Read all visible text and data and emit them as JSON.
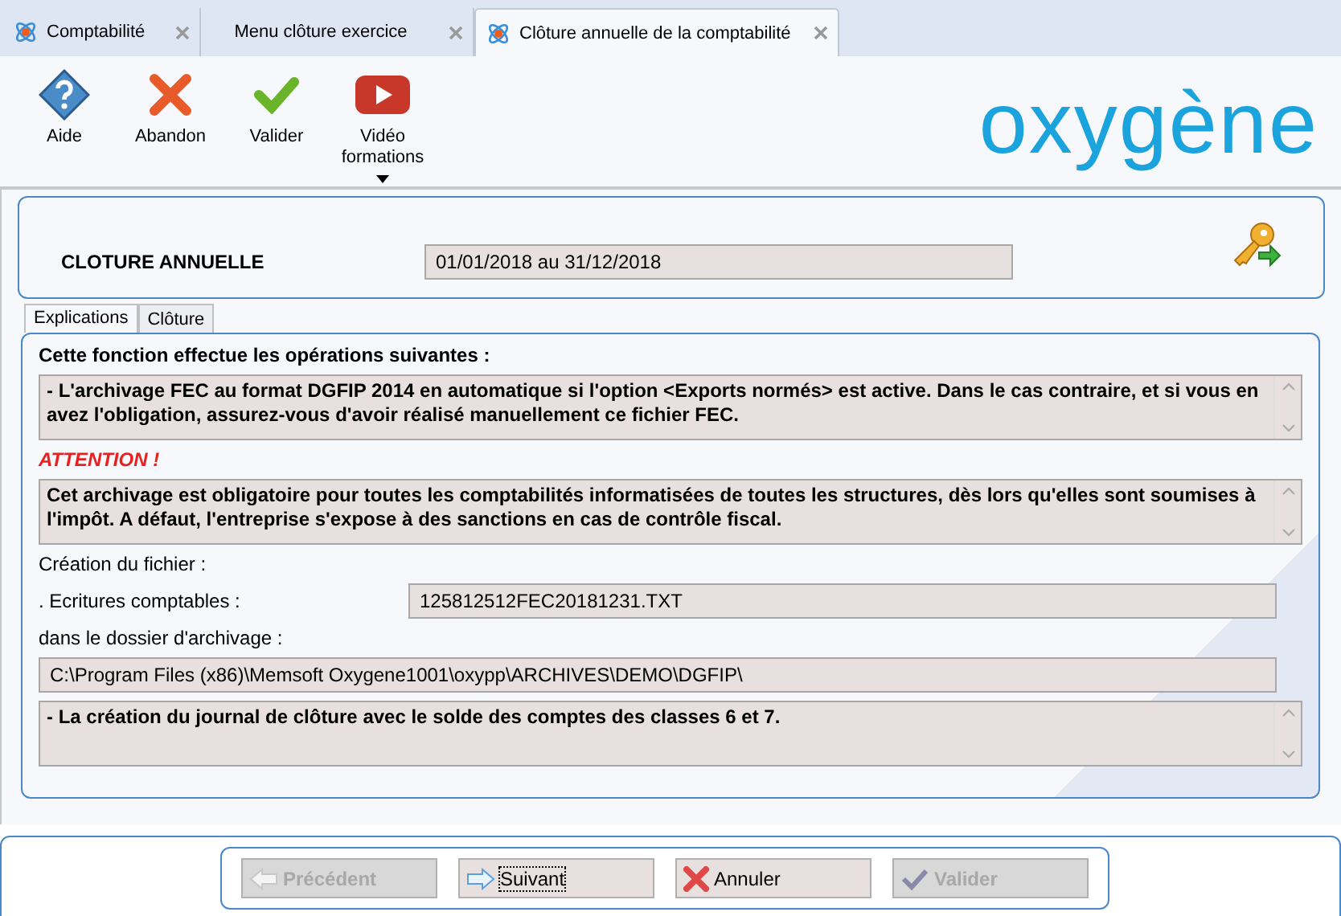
{
  "tabs": [
    {
      "label": "Comptabilité",
      "selected": false,
      "kind": "app"
    },
    {
      "label": "Menu clôture exercice",
      "selected": false,
      "kind": "plain"
    },
    {
      "label": "Clôture annuelle de la comptabilité",
      "selected": true,
      "kind": "app"
    }
  ],
  "toolbar": [
    {
      "label": "Aide",
      "kind": "help"
    },
    {
      "label": "Abandon",
      "kind": "cancel"
    },
    {
      "label": "Valider",
      "kind": "check"
    },
    {
      "label": "Vidéo formations",
      "kind": "video",
      "dropdown": true
    }
  ],
  "logo": "oxygène",
  "header": {
    "label": "CLOTURE ANNUELLE",
    "value": "01/01/2018 au 31/12/2018"
  },
  "inner_tabs": [
    {
      "label": "Explications",
      "selected": true
    },
    {
      "label": "Clôture",
      "selected": false
    }
  ],
  "content": [
    {
      "kind": "heading",
      "text": "Cette fonction effectue les opérations suivantes :"
    },
    {
      "kind": "memo",
      "text": "- L'archivage FEC au format DGFIP 2014 en automatique si l'option <Exports normés> est active. Dans le cas contraire, et si vous en avez l'obligation, assurez-vous d'avoir réalisé manuellement ce fichier FEC."
    },
    {
      "kind": "warning",
      "text": "ATTENTION !"
    },
    {
      "kind": "memo",
      "text": "Cet archivage est obligatoire pour toutes les comptabilités informatisées de toutes les structures, dès lors qu'elles sont soumises à l'impôt. A défaut, l'entreprise s'expose à des sanctions en cas de contrôle fiscal."
    },
    {
      "kind": "label",
      "text": "Création du fichier :"
    },
    {
      "kind": "field",
      "label": ". Ecritures comptables :",
      "value": "125812512FEC20181231.TXT"
    },
    {
      "kind": "label",
      "text": "dans le dossier d'archivage :"
    },
    {
      "kind": "path",
      "value": "C:\\Program Files (x86)\\Memsoft Oxygene1001\\oxypp\\ARCHIVES\\DEMO\\DGFIP\\"
    },
    {
      "kind": "memo",
      "text": "- La création du journal de clôture avec le solde des comptes des classes 6 et 7."
    }
  ],
  "buttons": [
    {
      "label": "Précédent",
      "kind": "previous",
      "disabled": true,
      "focused": false
    },
    {
      "label": "Suivant",
      "kind": "next",
      "disabled": false,
      "focused": true
    },
    {
      "label": "Annuler",
      "kind": "cancel",
      "disabled": false,
      "focused": false
    },
    {
      "label": "Valider",
      "kind": "validate",
      "disabled": true,
      "focused": false
    }
  ]
}
